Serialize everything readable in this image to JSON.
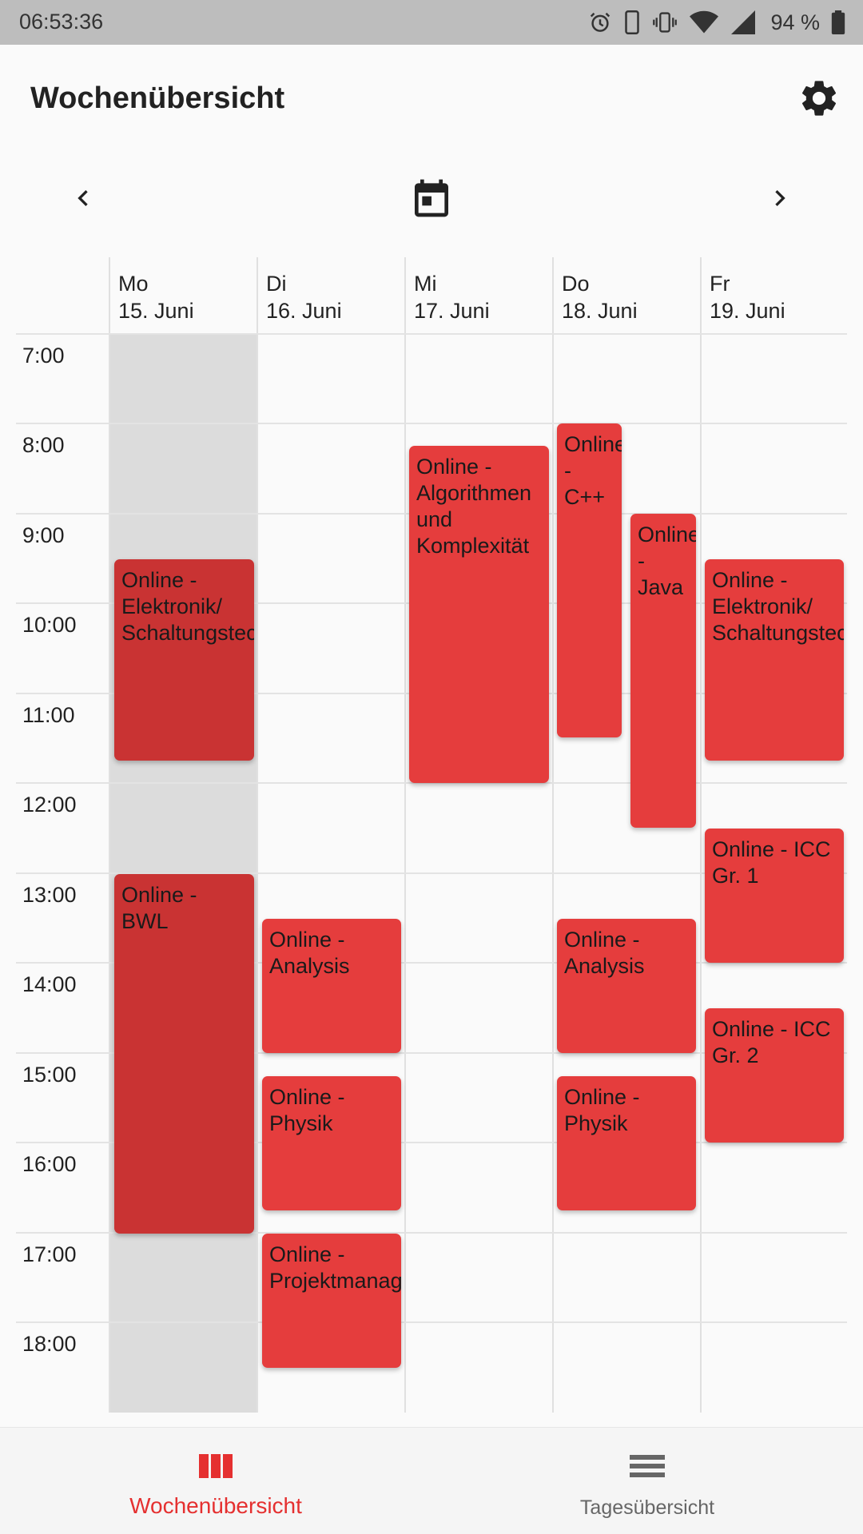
{
  "status_bar": {
    "time": "06:53:36",
    "battery": "94 %",
    "icons": [
      "alarm-icon",
      "phone-outline-icon",
      "vibrate-icon",
      "wifi-icon",
      "signal-icon",
      "battery-icon"
    ]
  },
  "app_bar": {
    "title": "Wochenübersicht",
    "settings_icon": "gear-icon"
  },
  "week_nav": {
    "prev_icon": "chevron-left-icon",
    "calendar_icon": "calendar-icon",
    "next_icon": "chevron-right-icon"
  },
  "days": [
    {
      "weekday": "Mo",
      "date": "15. Juni"
    },
    {
      "weekday": "Di",
      "date": "16. Juni"
    },
    {
      "weekday": "Mi",
      "date": "17. Juni"
    },
    {
      "weekday": "Do",
      "date": "18. Juni"
    },
    {
      "weekday": "Fr",
      "date": "19. Juni"
    }
  ],
  "hours": [
    "7:00",
    "8:00",
    "9:00",
    "10:00",
    "11:00",
    "12:00",
    "13:00",
    "14:00",
    "15:00",
    "16:00",
    "17:00",
    "18:00"
  ],
  "events": [
    {
      "title": "Online - Elektronik/ Schaltungstechnik",
      "day": 0
    },
    {
      "title": "Online - BWL",
      "day": 0
    },
    {
      "title": "Online - Analysis",
      "day": 1
    },
    {
      "title": "Online - Physik",
      "day": 1
    },
    {
      "title": "Online - Projektmanagement",
      "day": 1
    },
    {
      "title": "Online - Algorithmen und Komplexität",
      "day": 2
    },
    {
      "title": "Online - C++",
      "day": 3
    },
    {
      "title": "Online - Java",
      "day": 3
    },
    {
      "title": "Online - Analysis",
      "day": 3
    },
    {
      "title": "Online - Physik",
      "day": 3
    },
    {
      "title": "Online - Elektronik/ Schaltungstechnik",
      "day": 4
    },
    {
      "title": "Online - ICC Gr. 1",
      "day": 4
    },
    {
      "title": "Online - ICC Gr. 2",
      "day": 4
    }
  ],
  "bottom_nav": {
    "items": [
      {
        "label": "Wochenübersicht",
        "icon": "week-columns-icon",
        "active": true
      },
      {
        "label": "Tagesübersicht",
        "icon": "day-list-icon",
        "active": false
      }
    ]
  },
  "colors": {
    "event": "#e53d3d",
    "event_today": "#c93333",
    "accent": "#e53030",
    "today_background": "#dcdcdc"
  }
}
